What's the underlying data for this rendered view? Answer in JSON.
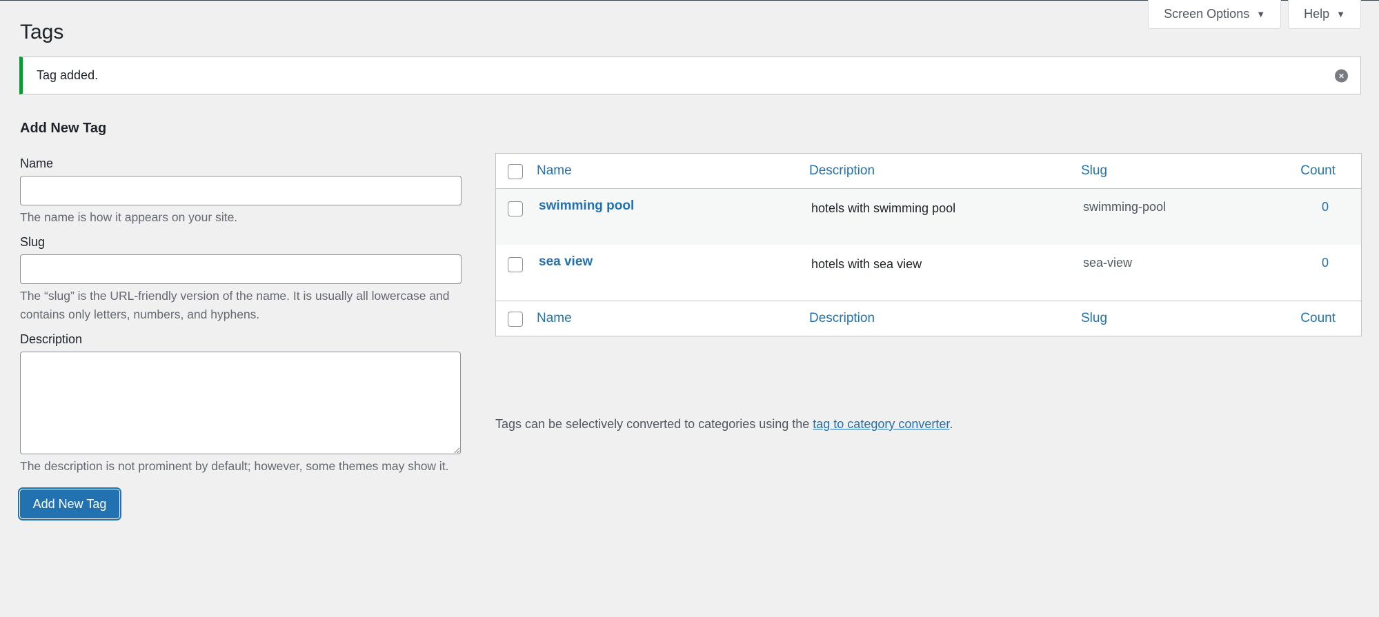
{
  "header": {
    "title": "Tags",
    "screen_options_label": "Screen Options",
    "help_label": "Help",
    "dropdown_arrow": "▼"
  },
  "notice": {
    "message": "Tag added.",
    "dismiss_symbol": "×",
    "accent_color": "#00a32a"
  },
  "form": {
    "heading": "Add New Tag",
    "name_label": "Name",
    "name_value": "",
    "name_hint": "The name is how it appears on your site.",
    "slug_label": "Slug",
    "slug_value": "",
    "slug_hint": "The “slug” is the URL-friendly version of the name. It is usually all lowercase and contains only letters, numbers, and hyphens.",
    "description_label": "Description",
    "description_value": "",
    "description_hint": "The description is not prominent by default; however, some themes may show it.",
    "submit_label": "Add New Tag",
    "primary_color": "#2271b1"
  },
  "table": {
    "columns": {
      "name": "Name",
      "description": "Description",
      "slug": "Slug",
      "count": "Count"
    },
    "rows": [
      {
        "name": "swimming pool",
        "description": "hotels with swimming pool",
        "slug": "swimming-pool",
        "count": "0"
      },
      {
        "name": "sea view",
        "description": "hotels with sea view",
        "slug": "sea-view",
        "count": "0"
      }
    ]
  },
  "footer_note": {
    "text_before": "Tags can be selectively converted to categories using the ",
    "link_text": "tag to category converter",
    "text_after": "."
  }
}
